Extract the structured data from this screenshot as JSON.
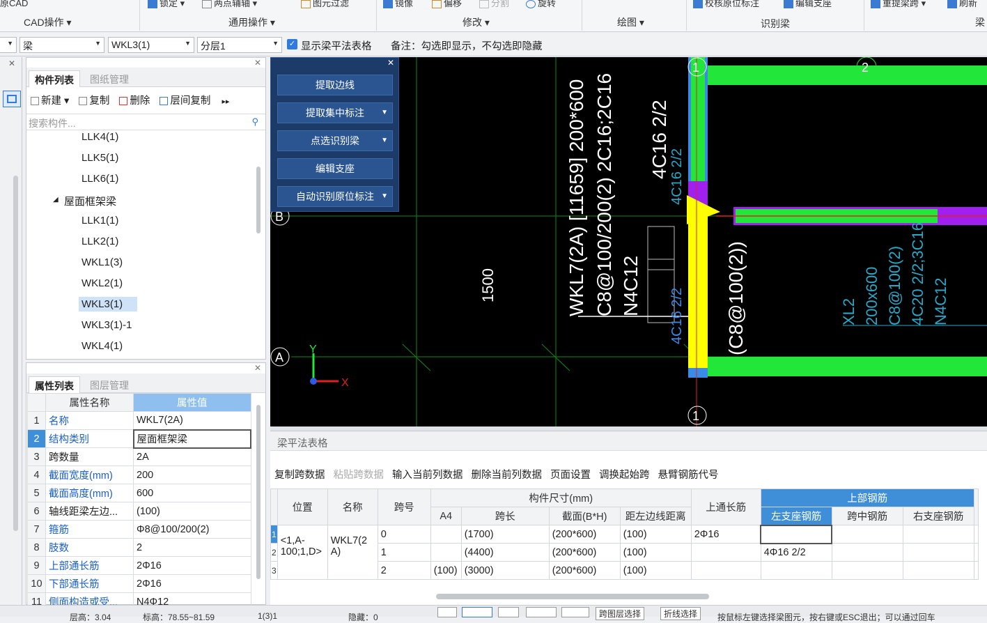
{
  "ribbon": {
    "top_items": [
      "原CAD",
      "锁定",
      "两点辅轴",
      "图元过滤",
      "镜像",
      "偏移",
      "分割",
      "旋转",
      "校核原位标注",
      "编辑支座",
      "重提梁跨",
      "刷新"
    ],
    "groups": [
      "CAD操作",
      "通用操作",
      "修改",
      "绘图",
      "识别梁",
      "梁"
    ]
  },
  "selector": {
    "category": "梁",
    "member": "WKL3(1)",
    "layer": "分层1",
    "show_table_label": "显示梁平法表格",
    "note": "备注：勾选即显示，不勾选即隐藏"
  },
  "component_panel": {
    "tabs": [
      "构件列表",
      "图纸管理"
    ],
    "toolbar": [
      "新建",
      "复制",
      "删除",
      "层间复制"
    ],
    "search_placeholder": "搜索构件...",
    "tree": [
      {
        "label": "LLK4(1)",
        "level": 2
      },
      {
        "label": "LLK5(1)",
        "level": 2
      },
      {
        "label": "LLK6(1)",
        "level": 2
      },
      {
        "label": "屋面框架梁",
        "level": 1
      },
      {
        "label": "LLK1(1)",
        "level": 2
      },
      {
        "label": "LLK2(1)",
        "level": 2
      },
      {
        "label": "WKL1(3)",
        "level": 2
      },
      {
        "label": "WKL2(1)",
        "level": 2
      },
      {
        "label": "WKL3(1)",
        "level": 2,
        "selected": true
      },
      {
        "label": "WKL3(1)-1",
        "level": 2
      },
      {
        "label": "WKL4(1)",
        "level": 2
      }
    ]
  },
  "property_panel": {
    "tabs": [
      "属性列表",
      "图层管理"
    ],
    "headers": [
      "属性名称",
      "属性值"
    ],
    "rows": [
      {
        "n": "1",
        "k": "名称",
        "v": "WKL7(2A)",
        "blue": true
      },
      {
        "n": "2",
        "k": "结构类别",
        "v": "屋面框架梁",
        "blue": true
      },
      {
        "n": "3",
        "k": "跨数量",
        "v": "2A",
        "blue": false
      },
      {
        "n": "4",
        "k": "截面宽度(mm)",
        "v": "200",
        "blue": true
      },
      {
        "n": "5",
        "k": "截面高度(mm)",
        "v": "600",
        "blue": true
      },
      {
        "n": "6",
        "k": "轴线距梁左边...",
        "v": "(100)",
        "blue": false
      },
      {
        "n": "7",
        "k": "箍筋",
        "v": "Φ8@100/200(2)",
        "blue": true
      },
      {
        "n": "8",
        "k": "肢数",
        "v": "2",
        "blue": true
      },
      {
        "n": "9",
        "k": "上部通长筋",
        "v": "2Φ16",
        "blue": true
      },
      {
        "n": "10",
        "k": "下部通长筋",
        "v": "2Φ16",
        "blue": true
      },
      {
        "n": "11",
        "k": "侧面构造或受...",
        "v": "N4Φ12",
        "blue": true
      }
    ]
  },
  "float_menu": {
    "items": [
      {
        "label": "提取边线",
        "dropdown": false
      },
      {
        "label": "提取集中标注",
        "dropdown": true
      },
      {
        "label": "点选识别梁",
        "dropdown": true
      },
      {
        "label": "编辑支座",
        "dropdown": false
      },
      {
        "label": "自动识别原位标注",
        "dropdown": true
      }
    ]
  },
  "canvas": {
    "axis_labels": [
      "1",
      "2",
      "B",
      "A",
      "1"
    ],
    "dim_1500": "1500",
    "beam_text_1": "WKL7(2A) [11659] 200*600",
    "beam_text_2": "C8@100/200(2) 2C16;2C16",
    "beam_text_3": "N4C12",
    "beam_text_4": "4C16 2/2",
    "beam_text_5": "4C16 2/2",
    "beam_text_6": "(C8@100(2))",
    "xl2_text_1": "XL2",
    "xl2_text_2": "200x600",
    "xl2_text_3": "C8@100(2)",
    "xl2_text_4": "4C20 2/2;3C16",
    "xl2_text_5": "N4C12",
    "x_axis": "X",
    "y_axis": "Y",
    "colors": {
      "beam_green": "#22e63a",
      "beam_yellow": "#ffff00",
      "beam_purple": "#a020f0",
      "beam_blue": "#3a8be8",
      "grid_green": "#0f8a17"
    }
  },
  "grid_pane": {
    "title": "梁平法表格",
    "toolbar": [
      "复制跨数据",
      "粘贴跨数据",
      "输入当前列数据",
      "删除当前列数据",
      "页面设置",
      "调换起始跨",
      "悬臂钢筋代号"
    ],
    "headers_top": [
      "位置",
      "名称",
      "跨号",
      "构件尺寸(mm)",
      "上通长筋",
      "上部钢筋"
    ],
    "headers_sub": [
      "A4",
      "跨长",
      "截面(B*H)",
      "距左边线距离",
      "左支座钢筋",
      "跨中钢筋",
      "右支座钢筋"
    ],
    "position": "<1,A-100;1,D>",
    "name": "WKL7(2A)",
    "rows": [
      {
        "span": "0",
        "a4": "",
        "len": "(1700)",
        "sec": "(200*600)",
        "dist": "(100)",
        "top": "2Φ16",
        "left": "",
        "mid": "",
        "right": ""
      },
      {
        "span": "1",
        "a4": "",
        "len": "(4400)",
        "sec": "(200*600)",
        "dist": "(100)",
        "top": "",
        "left": "4Φ16 2/2",
        "mid": "",
        "right": ""
      },
      {
        "span": "2",
        "a4": "(100)",
        "len": "(3000)",
        "sec": "(200*600)",
        "dist": "(100)",
        "top": "",
        "left": "",
        "mid": "",
        "right": ""
      }
    ],
    "row_nums": [
      "1",
      "2",
      "3"
    ]
  },
  "status": {
    "floor_height": "层高：3.04",
    "elevation": "标高：78.55~81.59",
    "count": "1(3)1",
    "hidden": "隐藏：0",
    "btn1": "跨图层选择",
    "btn2": "折线选择",
    "hint": "按鼠标左键选择梁图元，按右键或ESC退出；可以通过回车"
  }
}
